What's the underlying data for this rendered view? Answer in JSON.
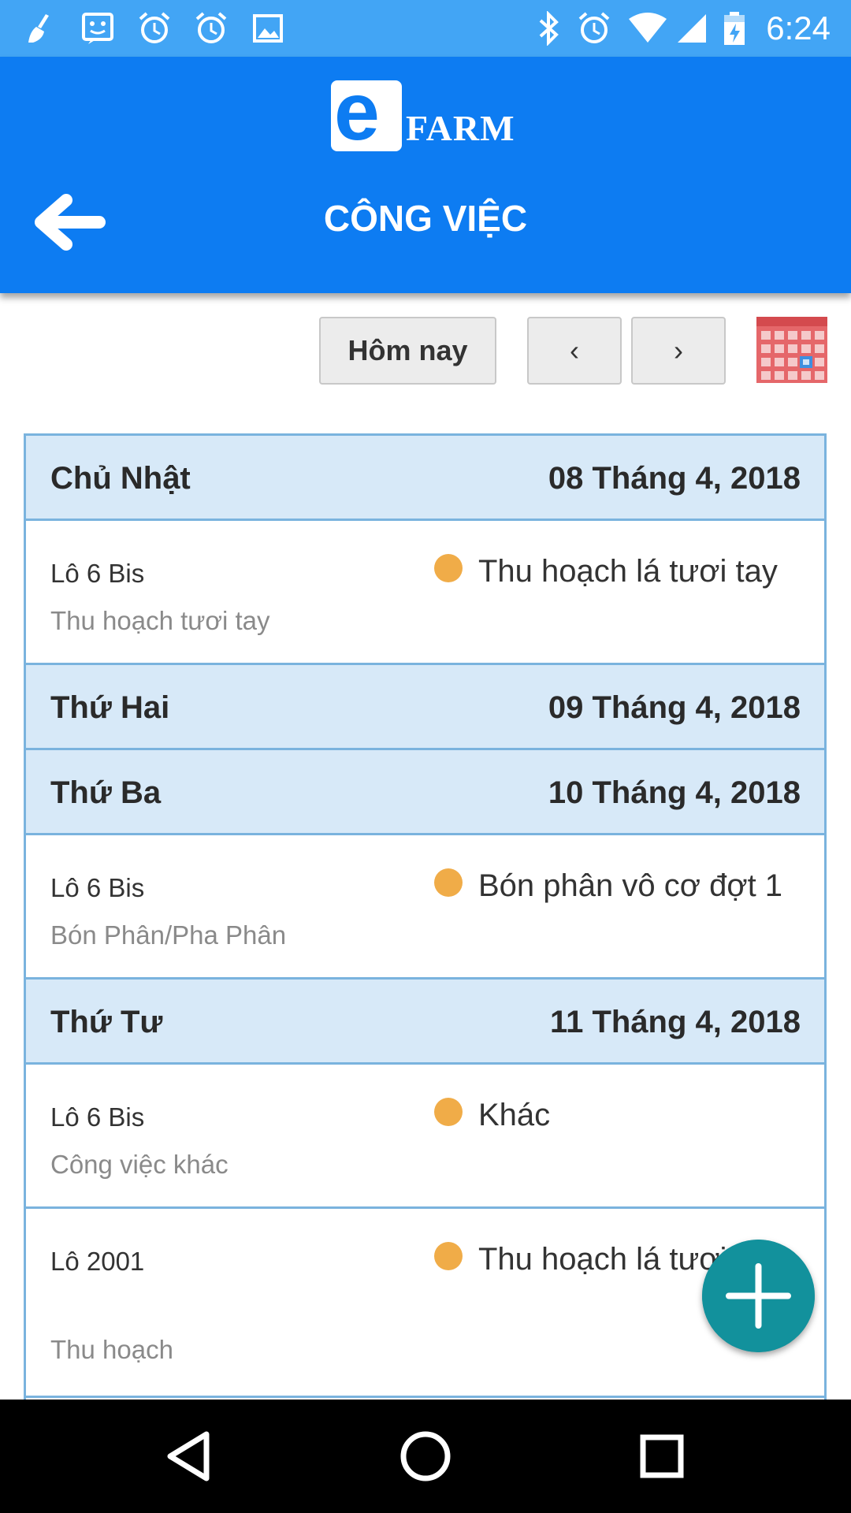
{
  "status_bar": {
    "time": "6:24",
    "left_icons": [
      "broom-icon",
      "face-icon",
      "alarm-icon",
      "alarm-icon",
      "image-icon"
    ],
    "right_icons": [
      "bluetooth-icon",
      "alarm-icon",
      "wifi-icon",
      "signal-icon",
      "battery-icon"
    ]
  },
  "app_bar": {
    "logo_letter": "e",
    "logo_text": "FARM",
    "title": "CÔNG VIỆC"
  },
  "toolbar": {
    "today_label": "Hôm nay",
    "prev_label": "‹",
    "next_label": "›"
  },
  "days": [
    {
      "name": "Chủ Nhật",
      "date": "08 Tháng 4, 2018",
      "tasks": [
        {
          "plot": "Lô 6 Bis",
          "type": "Thu hoạch tươi tay",
          "name": "Thu hoạch lá tươi tay"
        }
      ]
    },
    {
      "name": "Thứ Hai",
      "date": "09 Tháng 4, 2018",
      "tasks": []
    },
    {
      "name": "Thứ Ba",
      "date": "10 Tháng 4, 2018",
      "tasks": [
        {
          "plot": "Lô 6 Bis",
          "type": "Bón Phân/Pha Phân",
          "name": "Bón phân vô cơ đợt 1"
        }
      ]
    },
    {
      "name": "Thứ Tư",
      "date": "11 Tháng 4, 2018",
      "tasks": [
        {
          "plot": "Lô 6 Bis",
          "type": "Công việc khác",
          "name": "Khác"
        },
        {
          "plot": "Lô 2001",
          "type": "Thu hoạch",
          "name": "Thu hoạch lá tươi máy"
        }
      ]
    }
  ],
  "colors": {
    "app_bar": "#0d7cf2",
    "status_bar": "#42a5f5",
    "day_header": "#d7e9f8",
    "task_dot": "#f0ac48",
    "fab": "#12919c"
  }
}
